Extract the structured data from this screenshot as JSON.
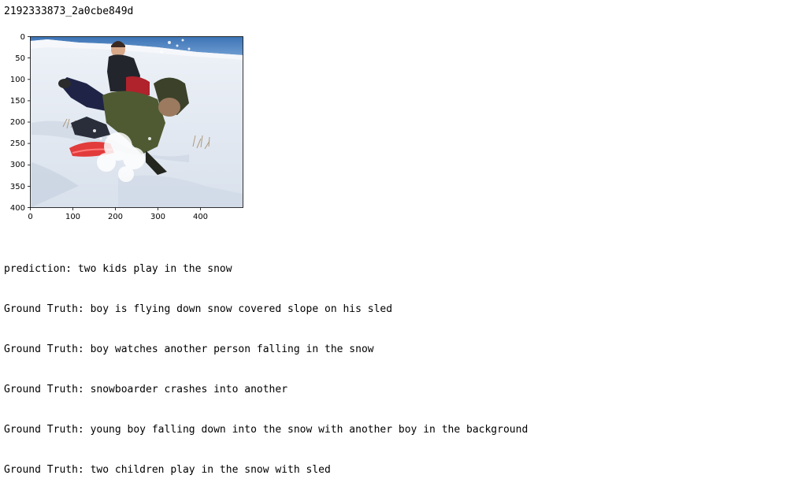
{
  "output": {
    "image_id": "2192333873_2a0cbe849d",
    "plot": {
      "y_ticks": [
        "0",
        "50",
        "100",
        "150",
        "200",
        "250",
        "300",
        "350",
        "400"
      ],
      "x_ticks": [
        "0",
        "100",
        "200",
        "300",
        "400"
      ],
      "photo_subject": "two children sledding in snow, one falling off a red sled"
    },
    "prediction_label": "prediction: two kids play in the snow",
    "ground_truths": [
      "Ground Truth: boy is flying down snow covered slope on his sled",
      "Ground Truth: boy watches another person falling in the snow",
      "Ground Truth: snowboarder crashes into another",
      "Ground Truth: young boy falling down into the snow with another boy in the background",
      "Ground Truth: two children play in the snow with sled"
    ]
  }
}
